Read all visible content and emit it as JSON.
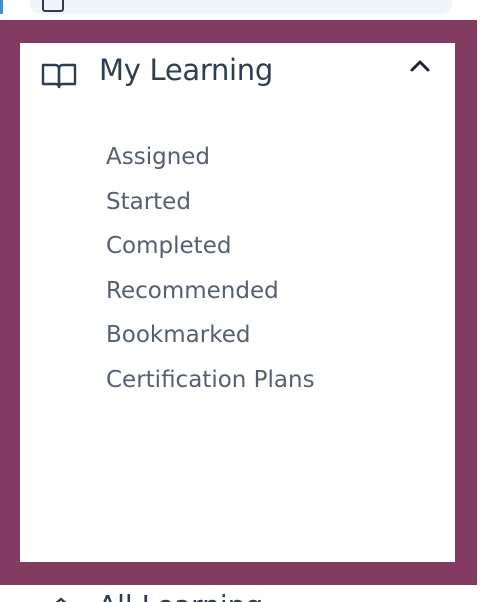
{
  "nav": {
    "section": {
      "label": "My Learning",
      "icon": "book-icon",
      "toggle_icon": "chevron-up-icon",
      "expanded": true,
      "items": [
        {
          "label": "Assigned"
        },
        {
          "label": "Started"
        },
        {
          "label": "Completed"
        },
        {
          "label": "Recommended"
        },
        {
          "label": "Bookmarked"
        },
        {
          "label": "Certification Plans"
        }
      ]
    },
    "next_item": {
      "label": "All Learning",
      "icon": "home-icon"
    }
  },
  "colors": {
    "highlight": "#843b62",
    "text_primary": "#2d3e50",
    "text_secondary": "#55606e",
    "prev_item_bg": "#eef5fb",
    "accent": "#3a8fd6"
  }
}
